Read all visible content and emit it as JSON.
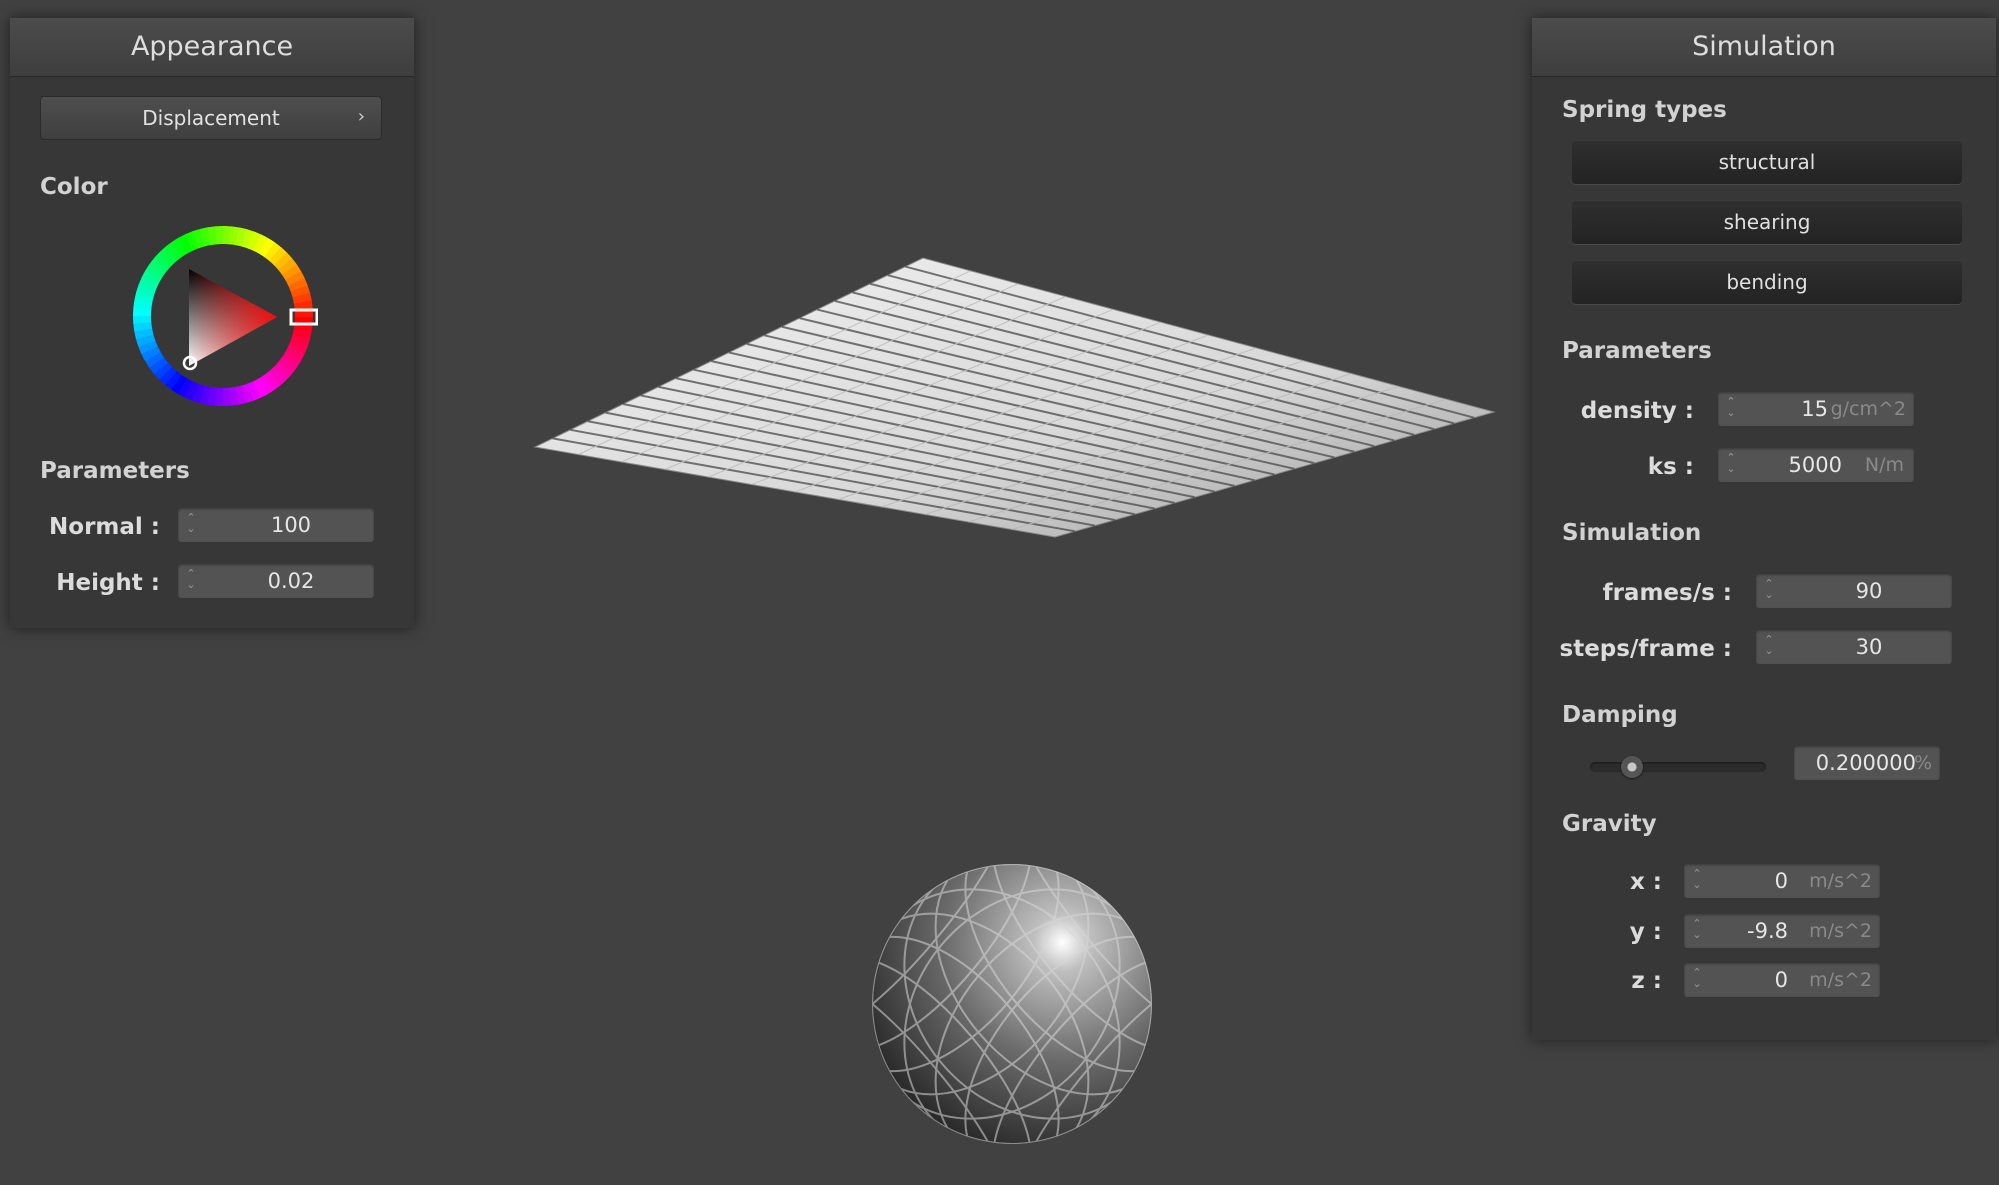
{
  "appearance": {
    "title": "Appearance",
    "dropdown": {
      "label": "Displacement"
    },
    "color_label": "Color",
    "color": {
      "hue": "#ff0000",
      "selected": "#e02020"
    },
    "parameters_label": "Parameters",
    "normal": {
      "label": "Normal :",
      "value": "100"
    },
    "height": {
      "label": "Height :",
      "value": "0.02"
    }
  },
  "simulation": {
    "title": "Simulation",
    "spring_types_label": "Spring types",
    "spring_types": [
      "structural",
      "shearing",
      "bending"
    ],
    "parameters_label": "Parameters",
    "density": {
      "label": "density :",
      "value": "15",
      "unit": "g/cm^2"
    },
    "ks": {
      "label": "ks :",
      "value": "5000",
      "unit": "N/m"
    },
    "simulation_label": "Simulation",
    "frames": {
      "label": "frames/s :",
      "value": "90"
    },
    "steps": {
      "label": "steps/frame :",
      "value": "30"
    },
    "damping_label": "Damping",
    "damping": {
      "value": "0.200000",
      "unit": "%",
      "slider_fraction": 0.2
    },
    "gravity_label": "Gravity",
    "gravity": {
      "x": {
        "label": "x :",
        "value": "0",
        "unit": "m/s^2"
      },
      "y": {
        "label": "y :",
        "value": "-9.8",
        "unit": "m/s^2"
      },
      "z": {
        "label": "z :",
        "value": "0",
        "unit": "m/s^2"
      }
    }
  }
}
